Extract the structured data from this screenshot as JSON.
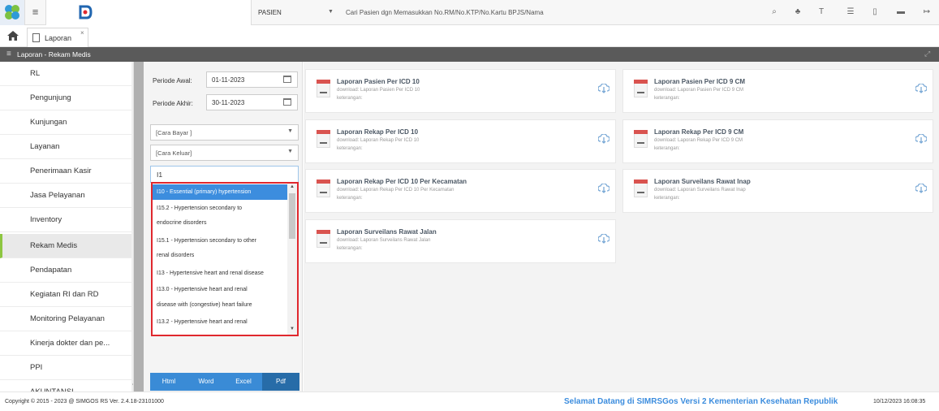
{
  "topbar": {
    "mode": "PASIEN",
    "search_placeholder": "Cari Pasien dgn Memasukkan No.RM/No.KTP/No.Kartu BPJS/Nama",
    "icons": [
      "search-icon",
      "user-add-icon",
      "text-icon",
      "list-icon",
      "document-icon",
      "folder-icon",
      "logout-icon"
    ]
  },
  "tabs": [
    {
      "label": "Laporan"
    }
  ],
  "section": {
    "title": "Laporan - Rekam Medis"
  },
  "sidebar": {
    "items": [
      {
        "label": "RL"
      },
      {
        "label": "Pengunjung"
      },
      {
        "label": "Kunjungan"
      },
      {
        "label": "Layanan"
      },
      {
        "label": "Penerimaan Kasir"
      },
      {
        "label": "Jasa Pelayanan"
      },
      {
        "label": "Inventory"
      },
      {
        "label": "Rekam Medis"
      },
      {
        "label": "Pendapatan"
      },
      {
        "label": "Kegiatan RI dan RD"
      },
      {
        "label": "Monitoring Pelayanan"
      },
      {
        "label": "Kinerja dokter dan pe..."
      },
      {
        "label": "PPI"
      },
      {
        "label": "AKUNTANSI"
      }
    ],
    "active": "Rekam Medis"
  },
  "filters": {
    "periode_awal_label": "Periode Awal:",
    "periode_awal_value": "01-11-2023",
    "periode_akhir_label": "Periode Akhir:",
    "periode_akhir_value": "30-11-2023",
    "cara_bayar": "[Cara Bayar ]",
    "cara_keluar": "[Cara Keluar]",
    "icd_query": "I1"
  },
  "dropdown": {
    "options": [
      "I10 - Essential (primary) hypertension",
      "I15.2 - Hypertension secondary to",
      "endocrine disorders",
      "I15.1 - Hypertension secondary to other",
      "renal disorders",
      "I13 - Hypertensive heart and renal disease",
      "I13.0 - Hypertensive heart and renal",
      "disease with (congestive) heart failure",
      "I13.2 - Hypertensive heart and renal"
    ]
  },
  "export": {
    "buttons": [
      "Html",
      "Word",
      "Excel",
      "Pdf"
    ]
  },
  "reports": [
    {
      "title": "Laporan Pasien Per ICD 10",
      "sub": "download: Laporan Pasien Per ICD 10",
      "desc": "keterangan:"
    },
    {
      "title": "Laporan Pasien Per ICD 9 CM",
      "sub": "download: Laporan Pasien Per ICD 9 CM",
      "desc": "keterangan:"
    },
    {
      "title": "Laporan Rekap Per ICD 10",
      "sub": "download: Laporan Rekap Per ICD 10",
      "desc": "keterangan:"
    },
    {
      "title": "Laporan Rekap Per ICD 9 CM",
      "sub": "download: Laporan Rekap Per ICD 9 CM",
      "desc": "keterangan:"
    },
    {
      "title": "Laporan Rekap Per ICD 10 Per Kecamatan",
      "sub": "download: Laporan Rekap Per ICD 10 Per Kecamatan",
      "desc": "keterangan:"
    },
    {
      "title": "Laporan Surveilans Rawat Inap",
      "sub": "download: Laporan Surveilans Rawat Inap",
      "desc": "keterangan:"
    },
    {
      "title": "Laporan Surveilans Rawat Jalan",
      "sub": "download: Laporan Surveilans Rawat Jalan",
      "desc": "keterangan:"
    }
  ],
  "footer": {
    "copyright": "Copyright © 2015 - 2023 @ SIMGOS RS Ver. 2.4.18-23101000",
    "welcome": "Selamat Datang di SIMRSGos Versi 2 Kementerian Kesehatan Republik",
    "timestamp": "10/12/2023 16:08:35"
  },
  "colors": {
    "accent": "#3c8dde",
    "header": "#5a5a5a",
    "highlight": "#e0282e",
    "active_bar": "#8dc641"
  }
}
